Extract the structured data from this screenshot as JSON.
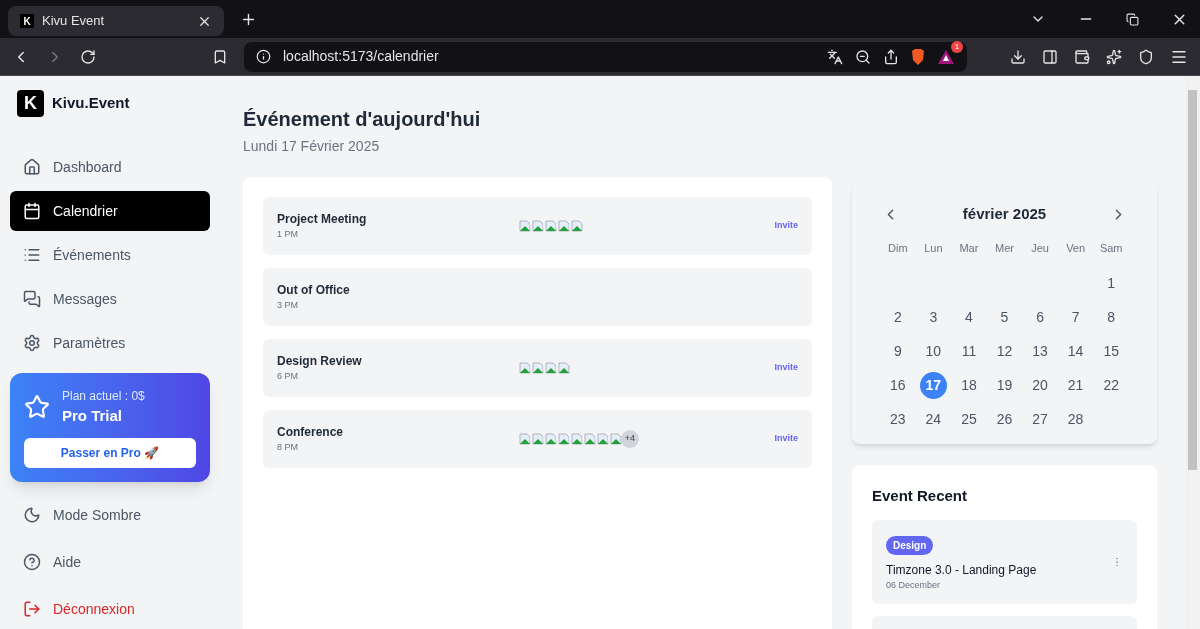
{
  "browser": {
    "tab": {
      "title": "Kivu Event",
      "logo_letter": "K"
    },
    "address": "localhost:5173/calendrier",
    "notification_badge": "1"
  },
  "sidebar": {
    "brand": "Kivu.Event",
    "logo_letter": "K",
    "items": [
      {
        "label": "Dashboard",
        "kind": "home",
        "selected": false
      },
      {
        "label": "Calendrier",
        "kind": "calendar",
        "selected": true
      },
      {
        "label": "Événements",
        "kind": "list",
        "selected": false
      },
      {
        "label": "Messages",
        "kind": "messages",
        "selected": false
      },
      {
        "label": "Paramètres",
        "kind": "settings",
        "selected": false
      }
    ],
    "plan": {
      "caption": "Plan actuel : 0$",
      "name": "Pro Trial",
      "button": "Passer en Pro 🚀"
    },
    "footer_items": [
      {
        "label": "Mode Sombre",
        "kind": "moon",
        "danger": false
      },
      {
        "label": "Aide",
        "kind": "help",
        "danger": false
      },
      {
        "label": "Déconnexion",
        "kind": "logout",
        "danger": true
      }
    ]
  },
  "header": {
    "title": "Événement d'aujourd'hui",
    "date": "Lundi 17 Février 2025"
  },
  "events": [
    {
      "title": "Project Meeting",
      "time": "1 PM",
      "attendees": [
        {
          "kind": "broken-image"
        },
        {
          "kind": "broken-image"
        },
        {
          "kind": "broken-image"
        },
        {
          "kind": "broken-image"
        },
        {
          "kind": "broken-image"
        }
      ],
      "action": "Invite"
    },
    {
      "title": "Out of Office",
      "time": "3 PM"
    },
    {
      "title": "Design Review",
      "time": "6 PM",
      "attendees": [
        {
          "kind": "broken-image"
        },
        {
          "kind": "broken-image"
        },
        {
          "kind": "broken-image"
        },
        {
          "kind": "broken-image"
        }
      ],
      "action": "Invite"
    },
    {
      "title": "Conference",
      "time": "8 PM",
      "attendees": [
        {
          "kind": "broken-image"
        },
        {
          "kind": "broken-image"
        },
        {
          "kind": "broken-image"
        },
        {
          "kind": "broken-image"
        },
        {
          "kind": "broken-image"
        },
        {
          "kind": "broken-image"
        },
        {
          "kind": "broken-image"
        },
        {
          "kind": "broken-image"
        }
      ],
      "more": "+4",
      "action": "Invite"
    }
  ],
  "calendar": {
    "month": "février 2025",
    "weekdays": [
      "Dim",
      "Lun",
      "Mar",
      "Mer",
      "Jeu",
      "Ven",
      "Sam"
    ],
    "weeks": [
      [
        {
          "kind": "blank"
        },
        {
          "kind": "blank"
        },
        {
          "kind": "blank"
        },
        {
          "kind": "blank"
        },
        {
          "kind": "blank"
        },
        {
          "kind": "blank"
        },
        {
          "kind": "day",
          "day": "1",
          "selected": false
        }
      ],
      [
        {
          "kind": "day",
          "day": "2",
          "selected": false
        },
        {
          "kind": "day",
          "day": "3",
          "selected": false
        },
        {
          "kind": "day",
          "day": "4",
          "selected": false
        },
        {
          "kind": "day",
          "day": "5",
          "selected": false
        },
        {
          "kind": "day",
          "day": "6",
          "selected": false
        },
        {
          "kind": "day",
          "day": "7",
          "selected": false
        },
        {
          "kind": "day",
          "day": "8",
          "selected": false
        }
      ],
      [
        {
          "kind": "day",
          "day": "9",
          "selected": false
        },
        {
          "kind": "day",
          "day": "10",
          "selected": false
        },
        {
          "kind": "day",
          "day": "11",
          "selected": false
        },
        {
          "kind": "day",
          "day": "12",
          "selected": false
        },
        {
          "kind": "day",
          "day": "13",
          "selected": false
        },
        {
          "kind": "day",
          "day": "14",
          "selected": false
        },
        {
          "kind": "day",
          "day": "15",
          "selected": false
        }
      ],
      [
        {
          "kind": "day",
          "day": "16",
          "selected": false
        },
        {
          "kind": "day",
          "day": "17",
          "selected": true
        },
        {
          "kind": "day",
          "day": "18",
          "selected": false
        },
        {
          "kind": "day",
          "day": "19",
          "selected": false
        },
        {
          "kind": "day",
          "day": "20",
          "selected": false
        },
        {
          "kind": "day",
          "day": "21",
          "selected": false
        },
        {
          "kind": "day",
          "day": "22",
          "selected": false
        }
      ],
      [
        {
          "kind": "day",
          "day": "23",
          "selected": false
        },
        {
          "kind": "day",
          "day": "24",
          "selected": false
        },
        {
          "kind": "day",
          "day": "25",
          "selected": false
        },
        {
          "kind": "day",
          "day": "26",
          "selected": false
        },
        {
          "kind": "day",
          "day": "27",
          "selected": false
        },
        {
          "kind": "day",
          "day": "28",
          "selected": false
        },
        {
          "kind": "blank"
        }
      ]
    ]
  },
  "recent": {
    "title": "Event Recent",
    "items": [
      {
        "kind": "event",
        "tag": "Design",
        "color": "#6366f1",
        "title": "Timzone 3.0 - Landing Page",
        "date": "06 December"
      },
      {
        "kind": "cut"
      }
    ]
  }
}
